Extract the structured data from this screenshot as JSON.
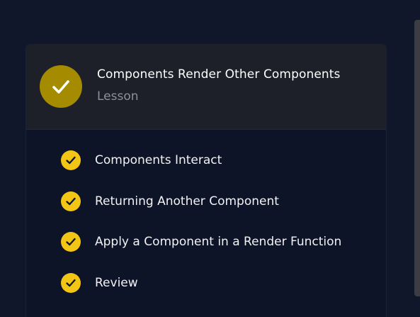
{
  "lesson": {
    "title": "Components Render Other Components",
    "type_label": "Lesson",
    "status_icon": "check-circle-icon",
    "accent_color": "#a58b00"
  },
  "items": [
    {
      "label": "Components Interact",
      "status": "completed",
      "icon": "check-circle-icon"
    },
    {
      "label": "Returning Another Component",
      "status": "completed",
      "icon": "check-circle-icon"
    },
    {
      "label": "Apply a Component in a Render Function",
      "status": "completed",
      "icon": "check-circle-icon"
    },
    {
      "label": "Review",
      "status": "completed",
      "icon": "check-circle-icon"
    }
  ],
  "colors": {
    "background": "#10172a",
    "header_background": "#1d1f29",
    "check_yellow": "#f3c515",
    "text_primary": "#ffffff",
    "text_secondary": "#8e9099"
  }
}
